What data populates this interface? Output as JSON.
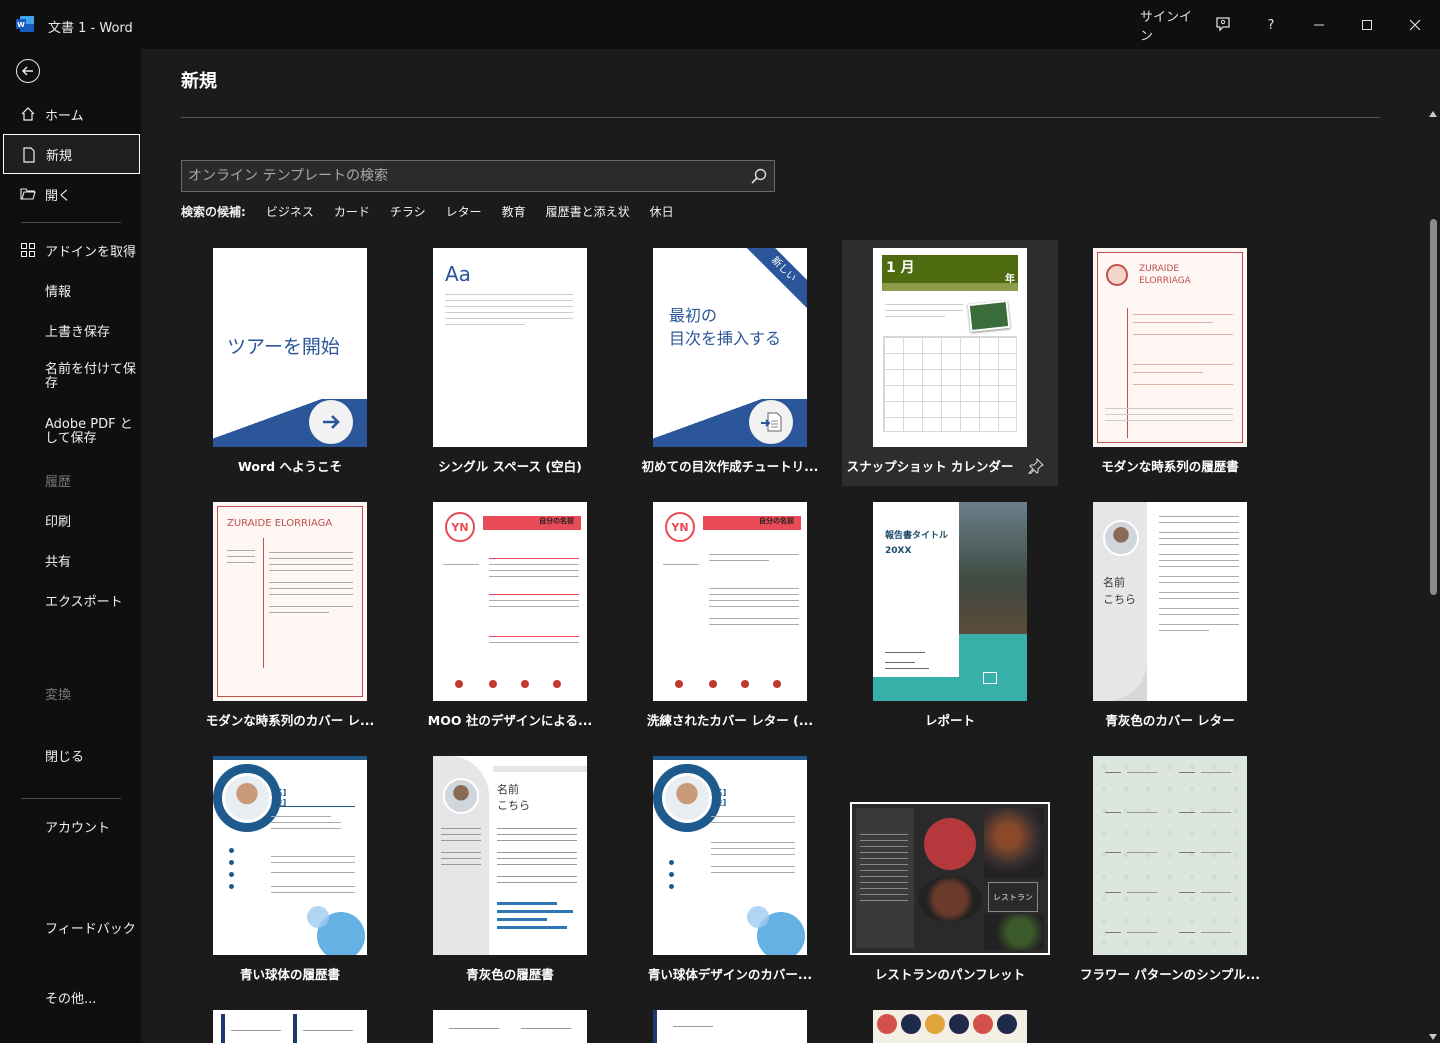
{
  "window": {
    "app_icon": "word-icon",
    "title": "文書 1 - Word",
    "signin": "サインイン",
    "help": "?",
    "controls": [
      "minimize-icon",
      "maximize-icon",
      "close-icon"
    ]
  },
  "sidebar": {
    "items": [
      {
        "label": "ホーム",
        "icon": "home-icon"
      },
      {
        "label": "新規",
        "icon": "new-document-icon",
        "selected": true
      },
      {
        "label": "開く",
        "icon": "folder-open-icon"
      },
      {
        "label": "アドインを取得",
        "icon": "grid-icon"
      },
      {
        "label": "情報"
      },
      {
        "label": "上書き保存"
      },
      {
        "label": "名前を付けて保存"
      },
      {
        "label": "Adobe PDF として保存"
      },
      {
        "label": "履歴",
        "disabled": true
      },
      {
        "label": "印刷"
      },
      {
        "label": "共有"
      },
      {
        "label": "エクスポート"
      },
      {
        "label": "変換",
        "disabled": true
      },
      {
        "label": "閉じる"
      },
      {
        "label": "アカウント"
      },
      {
        "label": "フィードバック"
      },
      {
        "label": "その他..."
      }
    ]
  },
  "main": {
    "title": "新規",
    "search": {
      "placeholder": "オンライン テンプレートの検索"
    },
    "suggestions": {
      "heading": "検索の候補:",
      "items": [
        "ビジネス",
        "カード",
        "チラシ",
        "レター",
        "教育",
        "履歴書と添え状",
        "休日"
      ]
    },
    "templates": [
      {
        "label": "Word へようこそ",
        "thumb_text": "ツアーを開始"
      },
      {
        "label": "シングル スペース (空白)",
        "thumb_text": "Aa"
      },
      {
        "label": "初めての目次作成チュートリ...",
        "thumb_text": "最初の\n目次を挿入する",
        "ribbon": "新しい"
      },
      {
        "label": "スナップショット カレンダー",
        "thumb_text": "1 月",
        "thumb_year": "年"
      },
      {
        "label": "モダンな時系列の履歴書",
        "thumb_text": "ZURAIDE\nELORRIAGA"
      },
      {
        "label": "モダンな時系列のカバー レ...",
        "thumb_text": "ZURAIDE ELORRIAGA"
      },
      {
        "label": "MOO 社のデザインによる...",
        "thumb_text": "YN",
        "thumb_sub": "自分の名前"
      },
      {
        "label": "洗練されたカバー レター (...",
        "thumb_text": "YN",
        "thumb_sub": "自分の名前"
      },
      {
        "label": "レポート",
        "thumb_text": "報告書タイトル",
        "thumb_sub": "20XX"
      },
      {
        "label": "青灰色のカバー レター",
        "thumb_text": "名前\nこちら"
      },
      {
        "label": "青い球体の履歴書",
        "thumb_text": "[名]\n[姓]"
      },
      {
        "label": "青灰色の履歴書",
        "thumb_text": "名前\nこちら"
      },
      {
        "label": "青い球体デザインのカバー...",
        "thumb_text": "[名]\n[姓]"
      },
      {
        "label": "レストランのパンフレット",
        "thumb_text": "レストラン"
      },
      {
        "label": "フラワー パターンのシンプル...",
        "thumb_text": ""
      }
    ]
  }
}
